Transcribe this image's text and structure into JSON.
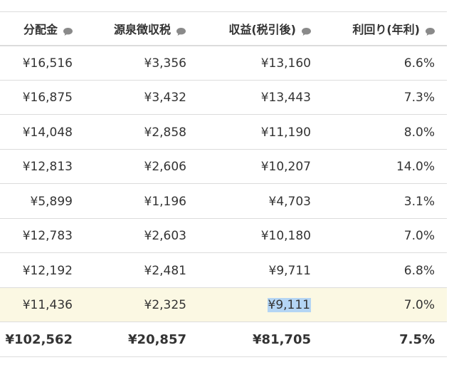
{
  "headers": [
    {
      "label": "分配金",
      "icon": "comment-icon"
    },
    {
      "label": "源泉徴収税",
      "icon": "comment-icon"
    },
    {
      "label": "収益(税引後)",
      "icon": "comment-icon"
    },
    {
      "label": "利回り(年利)",
      "icon": "comment-icon"
    }
  ],
  "rows": [
    {
      "cells": [
        "¥16,516",
        "¥3,356",
        "¥13,160",
        "6.6%"
      ]
    },
    {
      "cells": [
        "¥16,875",
        "¥3,432",
        "¥13,443",
        "7.3%"
      ]
    },
    {
      "cells": [
        "¥14,048",
        "¥2,858",
        "¥11,190",
        "8.0%"
      ]
    },
    {
      "cells": [
        "¥12,813",
        "¥2,606",
        "¥10,207",
        "14.0%"
      ]
    },
    {
      "cells": [
        "¥5,899",
        "¥1,196",
        "¥4,703",
        "3.1%"
      ]
    },
    {
      "cells": [
        "¥12,783",
        "¥2,603",
        "¥10,180",
        "7.0%"
      ]
    },
    {
      "cells": [
        "¥12,192",
        "¥2,481",
        "¥9,711",
        "6.8%"
      ]
    },
    {
      "cells": [
        "¥11,436",
        "¥2,325",
        "¥9,111",
        "7.0%"
      ]
    }
  ],
  "total": {
    "cells": [
      "¥102,562",
      "¥20,857",
      "¥81,705",
      "7.5%"
    ]
  },
  "colors": {
    "highlight_row": "#fbf8e3",
    "text_selection": "#b4d5f4",
    "border": "#dcdcdc",
    "icon": "#8a8a8a"
  },
  "highlighted_row_index": 7,
  "selected_cell": {
    "row": 7,
    "col": 2
  }
}
